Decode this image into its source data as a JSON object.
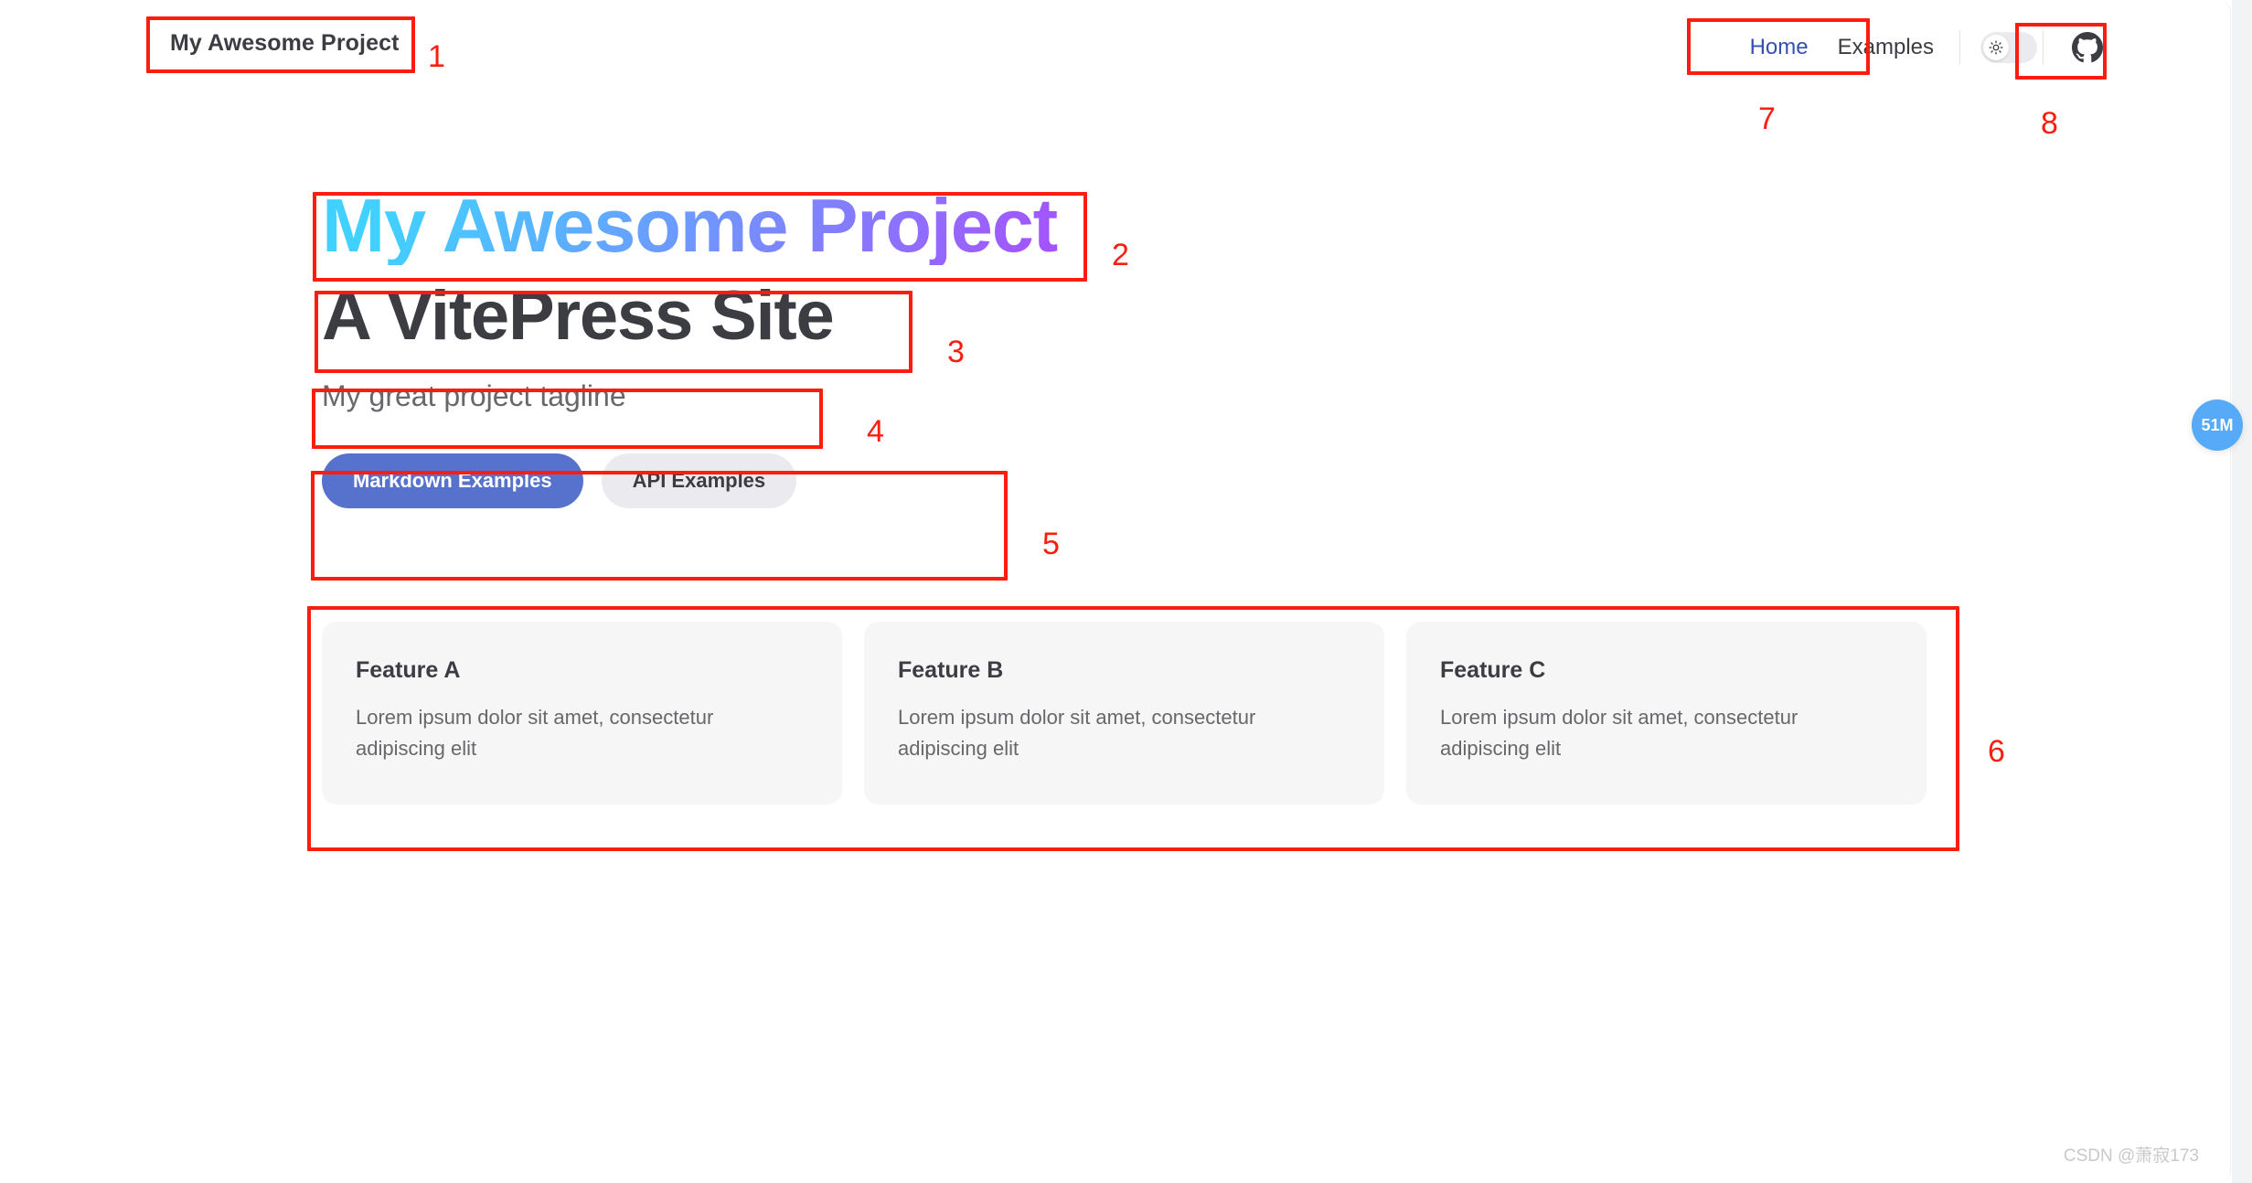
{
  "nav": {
    "site_title": "My Awesome Project",
    "links": [
      {
        "label": "Home",
        "active": true
      },
      {
        "label": "Examples",
        "active": false
      }
    ],
    "theme_toggle_icon": "sun-icon",
    "theme_toggle_state": "light",
    "social_icon": "github-icon"
  },
  "hero": {
    "name": "My Awesome Project",
    "text": "A VitePress Site",
    "tagline": "My great project tagline",
    "actions": [
      {
        "label": "Markdown Examples",
        "theme": "brand"
      },
      {
        "label": "API Examples",
        "theme": "alt"
      }
    ]
  },
  "features": [
    {
      "title": "Feature A",
      "details": "Lorem ipsum dolor sit amet, consectetur adipiscing elit"
    },
    {
      "title": "Feature B",
      "details": "Lorem ipsum dolor sit amet, consectetur adipiscing elit"
    },
    {
      "title": "Feature C",
      "details": "Lorem ipsum dolor sit amet, consectetur adipiscing elit"
    }
  ],
  "floating_badge": {
    "label": "51M"
  },
  "watermark": {
    "text": "CSDN @萧寂173"
  },
  "annotations": {
    "color": "#fb1e10",
    "markers": [
      {
        "number": "1",
        "target": "nav-site-title"
      },
      {
        "number": "2",
        "target": "hero-name"
      },
      {
        "number": "3",
        "target": "hero-text"
      },
      {
        "number": "4",
        "target": "hero-tagline"
      },
      {
        "number": "5",
        "target": "hero-actions"
      },
      {
        "number": "6",
        "target": "features-grid"
      },
      {
        "number": "7",
        "target": "nav-links"
      },
      {
        "number": "8",
        "target": "github-link"
      }
    ]
  }
}
